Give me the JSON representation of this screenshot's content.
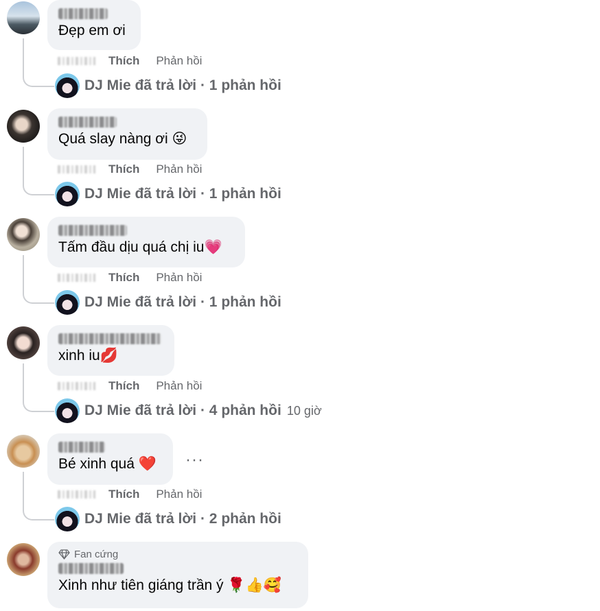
{
  "comments": [
    {
      "text": "Đẹp em ơi",
      "like_label": "Thích",
      "reply_label": "Phản hồi",
      "reply_summary": "DJ Mie đã trả lời · 1 phản hồi",
      "reply_time": ""
    },
    {
      "text": "Quá slay nàng ơi 😜",
      "like_label": "Thích",
      "reply_label": "Phản hồi",
      "reply_summary": "DJ Mie đã trả lời · 1 phản hồi",
      "reply_time": ""
    },
    {
      "text": "Tấm đầu dịu quá chị iu💗",
      "like_label": "Thích",
      "reply_label": "Phản hồi",
      "reply_summary": "DJ Mie đã trả lời · 1 phản hồi",
      "reply_time": ""
    },
    {
      "text": "xinh iu💋",
      "like_label": "Thích",
      "reply_label": "Phản hồi",
      "reply_summary": "DJ Mie đã trả lời · 4 phản hồi",
      "reply_time": "10 giờ"
    },
    {
      "text": "Bé xinh quá ❤️",
      "like_label": "Thích",
      "reply_label": "Phản hồi",
      "reply_summary": "DJ Mie đã trả lời · 2 phản hồi",
      "reply_time": "",
      "more": "···"
    },
    {
      "badge": "Fan cứng",
      "text": "Xinh như tiên giáng trần ý 🌹👍🥰"
    }
  ],
  "colors": {
    "bubble": "#f0f2f5",
    "secondary_text": "#65676b",
    "thread_line": "#ced0d4"
  }
}
